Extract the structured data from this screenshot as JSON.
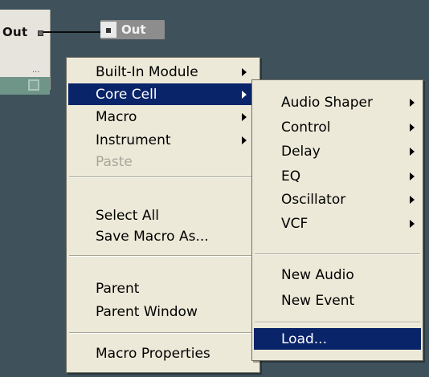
{
  "module": {
    "port_label": "Out",
    "dots": "...",
    "out_terminal_label": "Out"
  },
  "context_menu": {
    "items": [
      {
        "label": "Built-In Module",
        "submenu": true
      },
      {
        "label": "Core Cell",
        "submenu": true,
        "highlighted": true
      },
      {
        "label": "Macro",
        "submenu": true
      },
      {
        "label": "Instrument",
        "submenu": true
      },
      {
        "label": "Paste",
        "disabled": true
      },
      {
        "label": "Select All"
      },
      {
        "label": "Save Macro As..."
      },
      {
        "label": "Parent"
      },
      {
        "label": "Parent Window"
      },
      {
        "label": "Macro Properties"
      }
    ]
  },
  "core_cell_submenu": {
    "items": [
      {
        "label": "Audio Shaper",
        "submenu": true
      },
      {
        "label": "Control",
        "submenu": true
      },
      {
        "label": "Delay",
        "submenu": true
      },
      {
        "label": "EQ",
        "submenu": true
      },
      {
        "label": "Oscillator",
        "submenu": true
      },
      {
        "label": "VCF",
        "submenu": true
      },
      {
        "label": "New Audio"
      },
      {
        "label": "New Event"
      },
      {
        "label": "Load...",
        "highlighted": true
      }
    ]
  },
  "colors": {
    "background": "#3f525c",
    "menu_bg": "#ece9d8",
    "highlight": "#0a246a",
    "disabled_text": "#a8a69c"
  }
}
